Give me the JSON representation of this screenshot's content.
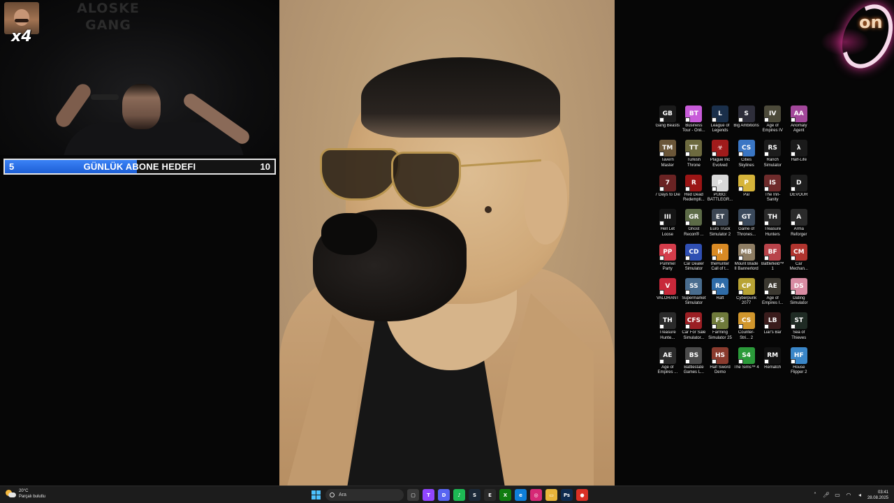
{
  "overlay": {
    "wall_text": "ALOSKE GANG",
    "emote_multiplier": "x4"
  },
  "sub_goal": {
    "start": "5",
    "title": "GÜNLÜK ABONE HEDEFI",
    "end": "10",
    "progress_fraction": 0.49,
    "fill_color": "#2f73e8"
  },
  "logo": {
    "text": "on",
    "accent_color": "#e0399a"
  },
  "desktop_icons": [
    {
      "label": "Gang Beasts",
      "color": "#1b1b1b",
      "glyph": "GB"
    },
    {
      "label": "Business Tour - Onli...",
      "color": "#c85bd9",
      "glyph": "BT"
    },
    {
      "label": "League of Legends",
      "color": "#1a2f4a",
      "glyph": "L"
    },
    {
      "label": "Big Ambitions",
      "color": "#2e2e3a",
      "glyph": "S"
    },
    {
      "label": "Age of Empires IV",
      "color": "#4c4a3a",
      "glyph": "IV"
    },
    {
      "label": "Anomaly Agent",
      "color": "#a2479a",
      "glyph": "AA"
    },
    {
      "label": "Tavern Master",
      "color": "#6b5638",
      "glyph": "TM"
    },
    {
      "label": "Turkish Throne",
      "color": "#6d6a3f",
      "glyph": "TT"
    },
    {
      "label": "Plague Inc Evolved",
      "color": "#a01b1b",
      "glyph": "☣"
    },
    {
      "label": "Cities Skylines",
      "color": "#3a76c4",
      "glyph": "CS"
    },
    {
      "label": "Ranch Simulator",
      "color": "#1c1c1c",
      "glyph": "RS"
    },
    {
      "label": "Half-Life",
      "color": "#1a1a1a",
      "glyph": "λ"
    },
    {
      "label": "7 Days to Die",
      "color": "#6a2323",
      "glyph": "7"
    },
    {
      "label": "Red Dead Redempti...",
      "color": "#9b1515",
      "glyph": "R"
    },
    {
      "label": "PUBG: BATTLEGR...",
      "color": "#d8d8d8",
      "glyph": "P"
    },
    {
      "label": "Pal",
      "color": "#d6b43a",
      "glyph": "P"
    },
    {
      "label": "The Inn-Sanity",
      "color": "#6e2b2b",
      "glyph": "IS"
    },
    {
      "label": "DEVOUR",
      "color": "#1e1e1e",
      "glyph": "D"
    },
    {
      "label": "Hell Let Loose",
      "color": "#151515",
      "glyph": "III"
    },
    {
      "label": "Ghost Recon® ...",
      "color": "#5c6b47",
      "glyph": "GR"
    },
    {
      "label": "Euro Truck Simulator 2",
      "color": "#3c4653",
      "glyph": "ET"
    },
    {
      "label": "Game of Thrones...",
      "color": "#3b4a5c",
      "glyph": "GT"
    },
    {
      "label": "Treasure Hunters",
      "color": "#2a2a2a",
      "glyph": "TH"
    },
    {
      "label": "Arma Reforger",
      "color": "#2a2a2a",
      "glyph": "A"
    },
    {
      "label": "Pummel Party",
      "color": "#d43c4a",
      "glyph": "PP"
    },
    {
      "label": "Car Dealer Simulator",
      "color": "#2f4fb3",
      "glyph": "CD"
    },
    {
      "label": "theHunter Call of t...",
      "color": "#d98a24",
      "glyph": "H"
    },
    {
      "label": "Mount  Blade II Bannerlord",
      "color": "#8e7d63",
      "glyph": "MB"
    },
    {
      "label": "Battlefield™ 1",
      "color": "#b8434a",
      "glyph": "BF"
    },
    {
      "label": "Car Mechan...",
      "color": "#b0342e",
      "glyph": "CM"
    },
    {
      "label": "VALORANT",
      "color": "#c8283a",
      "glyph": "V"
    },
    {
      "label": "Supermarket Simulator",
      "color": "#496d8f",
      "glyph": "SS"
    },
    {
      "label": "Raft",
      "color": "#2f6ca8",
      "glyph": "RA"
    },
    {
      "label": "Cyberpunk 2077",
      "color": "#b8a334",
      "glyph": "CP"
    },
    {
      "label": "Age of Empires I...",
      "color": "#3b3830",
      "glyph": "AE"
    },
    {
      "label": "Dating Simulator",
      "color": "#d98ca3",
      "glyph": "DS"
    },
    {
      "label": "Treasure Hunte...",
      "color": "#2a2a2a",
      "glyph": "TH"
    },
    {
      "label": "Car For Sale Simulator...",
      "color": "#9b1f24",
      "glyph": "CFS"
    },
    {
      "label": "Farming Simulator 25",
      "color": "#6f7a3b",
      "glyph": "FS"
    },
    {
      "label": "Counter-Stri... 2",
      "color": "#d1962c",
      "glyph": "CS"
    },
    {
      "label": "Liar's Bar",
      "color": "#3a1c1c",
      "glyph": "LB"
    },
    {
      "label": "Sea of Thieves",
      "color": "#1f2b24",
      "glyph": "ST"
    },
    {
      "label": "Age of Empires ...",
      "color": "#2b2b2b",
      "glyph": "AE"
    },
    {
      "label": "Battlestate Games L...",
      "color": "#4b4b4b",
      "glyph": "BS"
    },
    {
      "label": "Half Sword Demo",
      "color": "#8a3b2e",
      "glyph": "HS"
    },
    {
      "label": "The Sims™ 4",
      "color": "#2b9a3a",
      "glyph": "S4"
    },
    {
      "label": "Rematch",
      "color": "#111111",
      "glyph": "RM"
    },
    {
      "label": "House Flipper 2",
      "color": "#3a86c8",
      "glyph": "HF"
    }
  ],
  "taskbar": {
    "weather_temp": "20°C",
    "weather_desc": "Parçalı bulutlu",
    "search_placeholder": "Ara",
    "apps": [
      {
        "name": "taskview-icon",
        "color": "#3a3a3a",
        "glyph": "▢"
      },
      {
        "name": "twitch-icon",
        "color": "#9146ff",
        "glyph": "T"
      },
      {
        "name": "discord-icon",
        "color": "#5865f2",
        "glyph": "D"
      },
      {
        "name": "spotify-icon",
        "color": "#1db954",
        "glyph": "♪"
      },
      {
        "name": "steam-icon",
        "color": "#1b2838",
        "glyph": "S"
      },
      {
        "name": "epic-icon",
        "color": "#2a2a2a",
        "glyph": "E"
      },
      {
        "name": "xbox-icon",
        "color": "#107c10",
        "glyph": "X"
      },
      {
        "name": "edge-icon",
        "color": "#0f7fd8",
        "glyph": "e"
      },
      {
        "name": "instagram-icon",
        "color": "#d62976",
        "glyph": "◎"
      },
      {
        "name": "explorer-icon",
        "color": "#e8b43a",
        "glyph": "▭"
      },
      {
        "name": "photoshop-icon",
        "color": "#0f2b4f",
        "glyph": "Ps"
      },
      {
        "name": "chrome-icon",
        "color": "#d93025",
        "glyph": "●"
      }
    ],
    "time": "03:41",
    "date": "28.08.2025"
  }
}
